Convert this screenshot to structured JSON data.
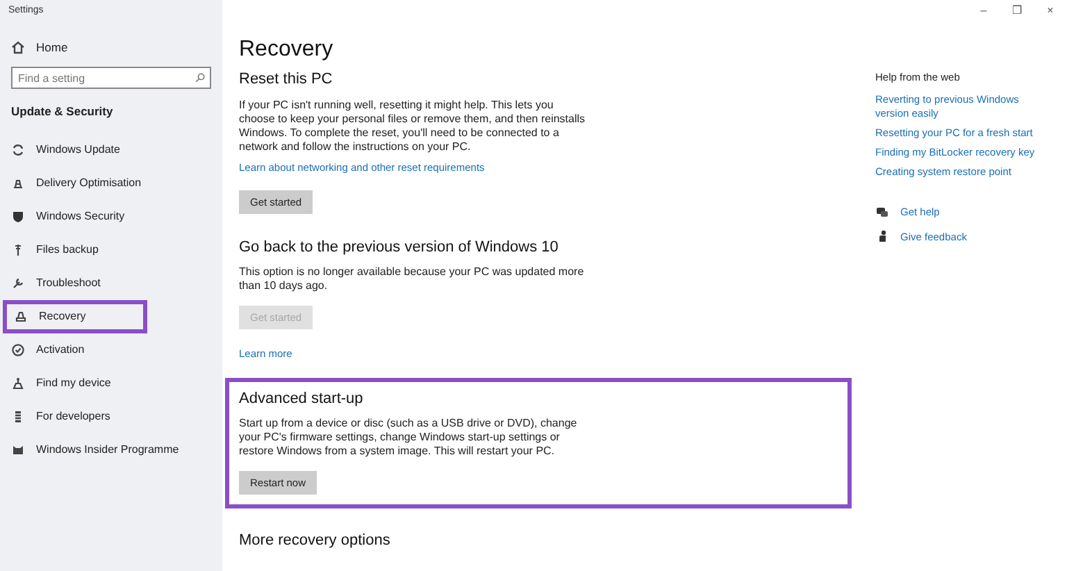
{
  "window": {
    "title": "Settings",
    "controls": [
      "–",
      "❐",
      "×"
    ]
  },
  "sidebar": {
    "home": "Home",
    "search": {
      "placeholder": "Find a setting"
    },
    "section": "Update & Security",
    "items": [
      {
        "label": "Windows Update",
        "highlighted": false
      },
      {
        "label": "Delivery Optimisation",
        "highlighted": false
      },
      {
        "label": "Windows Security",
        "highlighted": false
      },
      {
        "label": "Files backup",
        "highlighted": false
      },
      {
        "label": "Troubleshoot",
        "highlighted": false
      },
      {
        "label": "Recovery",
        "highlighted": true
      },
      {
        "label": "Activation",
        "highlighted": false
      },
      {
        "label": "Find my device",
        "highlighted": false
      },
      {
        "label": "For developers",
        "highlighted": false
      },
      {
        "label": "Windows Insider Programme",
        "highlighted": false
      }
    ]
  },
  "page": {
    "title": "Recovery",
    "sections": [
      {
        "heading": "Reset this PC",
        "text": "If your PC isn't running well, resetting it might help. This lets you choose to keep your personal files or remove them, and then reinstalls Windows. To complete the reset, you'll need to be connected to a network and follow the instructions on your PC.",
        "link": "Learn about networking and other reset requirements",
        "button": {
          "label": "Get started",
          "disabled": false
        },
        "highlighted": false
      },
      {
        "heading": "Go back to the previous version of Windows 10",
        "text": "This option is no longer available because your PC was updated more than 10 days ago.",
        "button": {
          "label": "Get started",
          "disabled": true
        },
        "link_after": "Learn more",
        "highlighted": false
      },
      {
        "heading": "Advanced start-up",
        "text": "Start up from a device or disc (such as a USB drive or DVD), change your PC's firmware settings, change Windows start-up settings or restore Windows from a system image. This will restart your PC.",
        "button": {
          "label": "Restart now",
          "disabled": false
        },
        "highlighted": true
      },
      {
        "heading": "More recovery options",
        "highlighted": false
      }
    ]
  },
  "help": {
    "title": "Help from the web",
    "links": [
      "Reverting to previous Windows version easily",
      "Resetting your PC for a fresh start",
      "Finding my BitLocker recovery key",
      "Creating system restore point"
    ],
    "actions": [
      "Get help",
      "Give feedback"
    ]
  }
}
